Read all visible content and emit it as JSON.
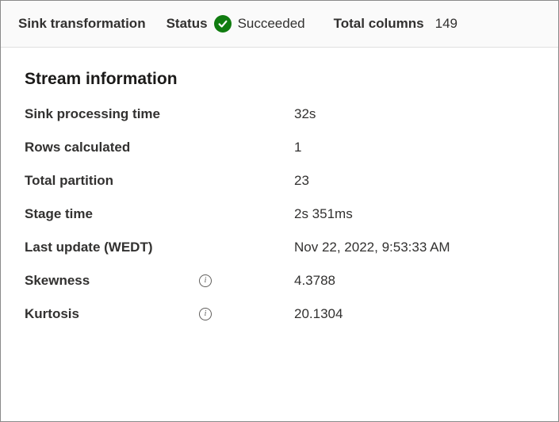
{
  "header": {
    "title": "Sink transformation",
    "status_label": "Status",
    "status_value": "Succeeded",
    "total_columns_label": "Total columns",
    "total_columns_value": "149"
  },
  "section": {
    "title": "Stream information",
    "rows": [
      {
        "label": "Sink processing time",
        "value": "32s",
        "has_info": false
      },
      {
        "label": "Rows calculated",
        "value": "1",
        "has_info": false
      },
      {
        "label": "Total partition",
        "value": "23",
        "has_info": false
      },
      {
        "label": "Stage time",
        "value": "2s 351ms",
        "has_info": false
      },
      {
        "label": "Last update (WEDT)",
        "value": "Nov 22, 2022, 9:53:33 AM",
        "has_info": false
      },
      {
        "label": "Skewness",
        "value": "4.3788",
        "has_info": true
      },
      {
        "label": "Kurtosis",
        "value": "20.1304",
        "has_info": true
      }
    ]
  }
}
